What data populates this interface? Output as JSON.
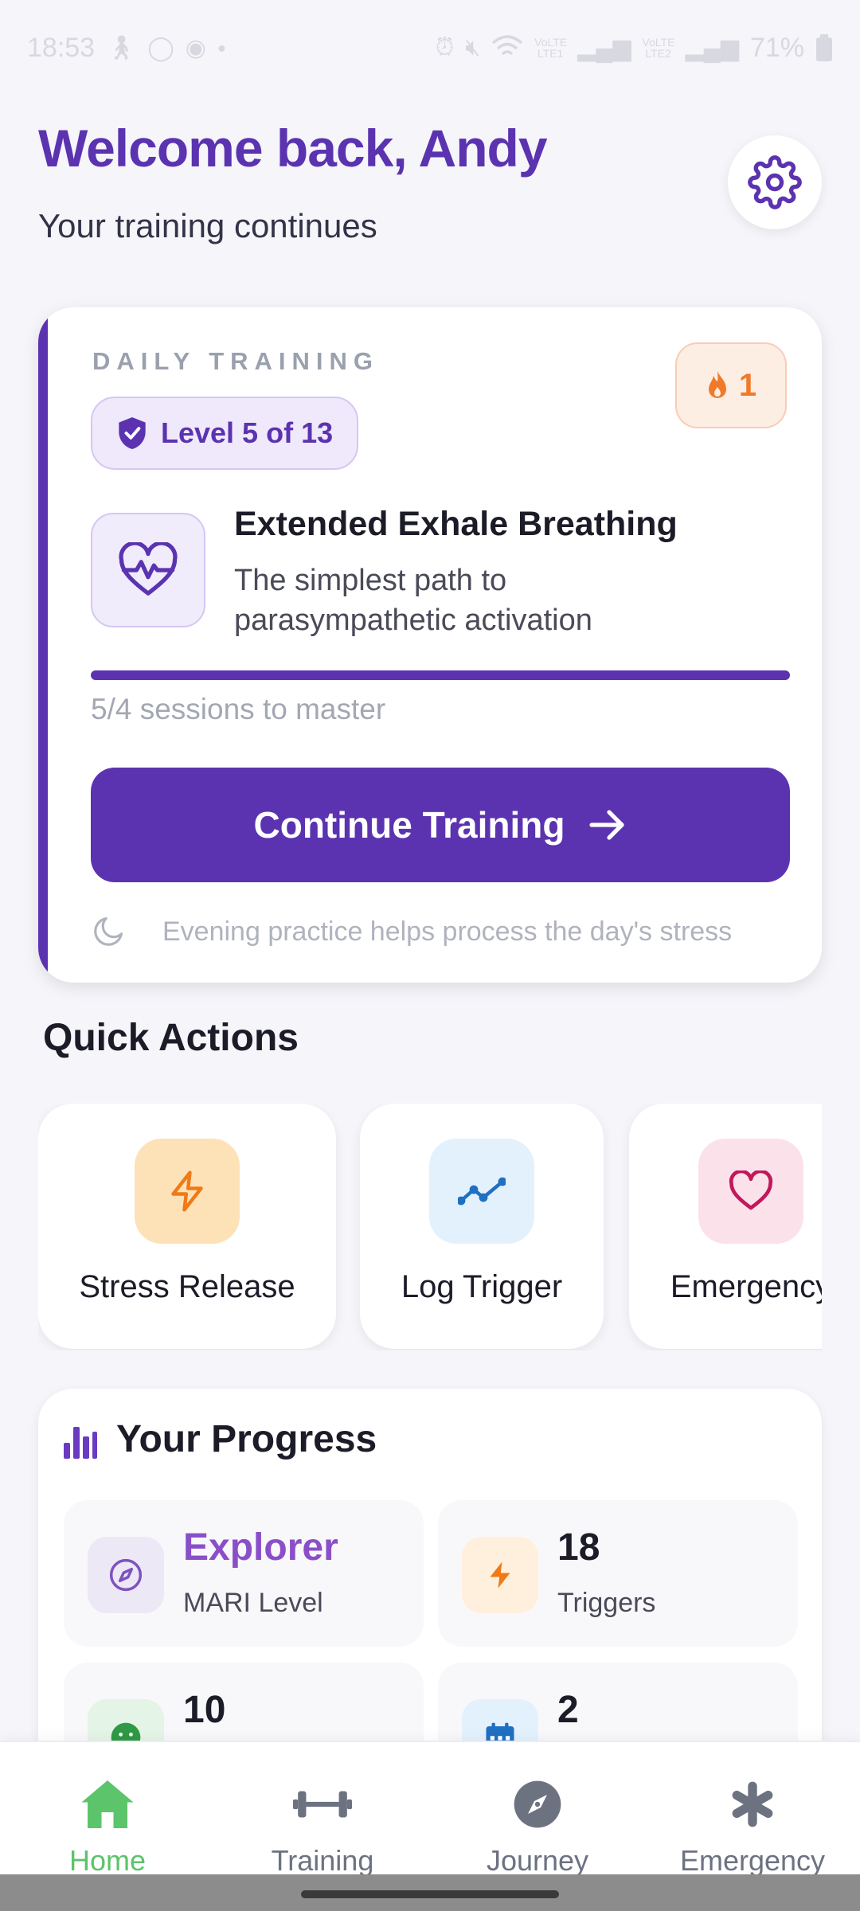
{
  "status_bar": {
    "time": "18:53",
    "battery": "71%",
    "left_icons": [
      "walk-icon",
      "whatsapp-icon",
      "location-icon",
      "dot-icon"
    ],
    "right_icons": [
      "alarm-icon",
      "mute-icon",
      "wifi-icon",
      "signal-lte1-icon",
      "signal-lte2-icon",
      "battery-icon"
    ],
    "lte1": "VoLTE LTE1",
    "lte2": "VoLTE LTE2"
  },
  "header": {
    "welcome": "Welcome back, Andy",
    "subtitle": "Your training continues"
  },
  "daily_training": {
    "label": "DAILY TRAINING",
    "streak": "1",
    "level": "Level 5 of 13",
    "exercise_title": "Extended Exhale Breathing",
    "exercise_description": "The simplest path to parasympathetic activation",
    "progress_fraction": 1.0,
    "sessions_text": "5/4 sessions to master",
    "continue_label": "Continue Training",
    "tip": "Evening practice helps process the day's stress"
  },
  "quick_actions": {
    "title": "Quick Actions",
    "items": [
      {
        "label": "Stress Release",
        "icon": "lightning-icon",
        "bg": "#fde2b8",
        "color": "#f07a16"
      },
      {
        "label": "Log Trigger",
        "icon": "trend-icon",
        "bg": "#e3f1fd",
        "color": "#1f6fc2"
      },
      {
        "label": "Emergency",
        "icon": "heart-icon",
        "bg": "#fbe2ea",
        "color": "#c2185b"
      }
    ]
  },
  "progress": {
    "title": "Your Progress",
    "stats": [
      {
        "value": "Explorer",
        "label": "MARI Level",
        "icon": "compass-icon"
      },
      {
        "value": "18",
        "label": "Triggers",
        "icon": "lightning-icon"
      },
      {
        "value": "10",
        "label": "",
        "icon": "smile-icon"
      },
      {
        "value": "2",
        "label": "",
        "icon": "calendar-icon"
      }
    ]
  },
  "bottom_nav": {
    "items": [
      {
        "label": "Home",
        "icon": "home-icon",
        "active": true
      },
      {
        "label": "Training",
        "icon": "dumbbell-icon",
        "active": false
      },
      {
        "label": "Journey",
        "icon": "compass-icon",
        "active": false
      },
      {
        "label": "Emergency",
        "icon": "asterisk-icon",
        "active": false
      }
    ]
  },
  "colors": {
    "primary": "#5b33b0",
    "active_nav": "#5cc46a",
    "streak": "#f07a2a"
  }
}
